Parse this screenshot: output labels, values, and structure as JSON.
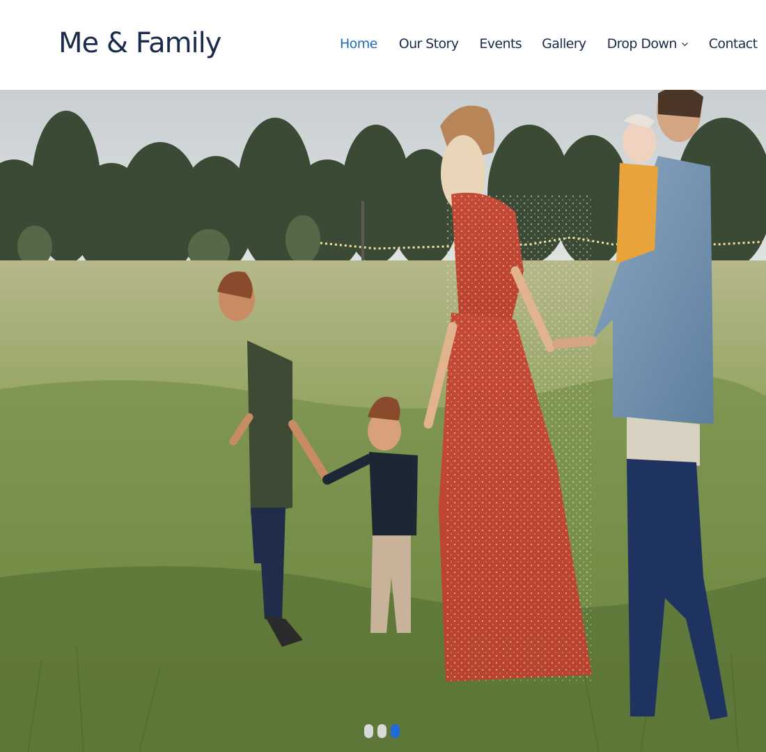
{
  "site": {
    "logo": "Me & Family"
  },
  "nav": {
    "items": [
      {
        "label": "Home",
        "active": true
      },
      {
        "label": "Our Story",
        "active": false
      },
      {
        "label": "Events",
        "active": false
      },
      {
        "label": "Gallery",
        "active": false
      },
      {
        "label": "Drop Down",
        "active": false,
        "icon": "chevron-down-icon"
      },
      {
        "label": "Contact",
        "active": false
      }
    ]
  },
  "hero": {
    "image": "family walking hand in hand through a grassy field",
    "slides": 3,
    "active_slide": 3
  },
  "colors": {
    "brand": "#1a2a4a",
    "accent": "#1f6bb8",
    "dot_inactive": "#d9d9d9",
    "dot_active": "#1f6bd6"
  }
}
